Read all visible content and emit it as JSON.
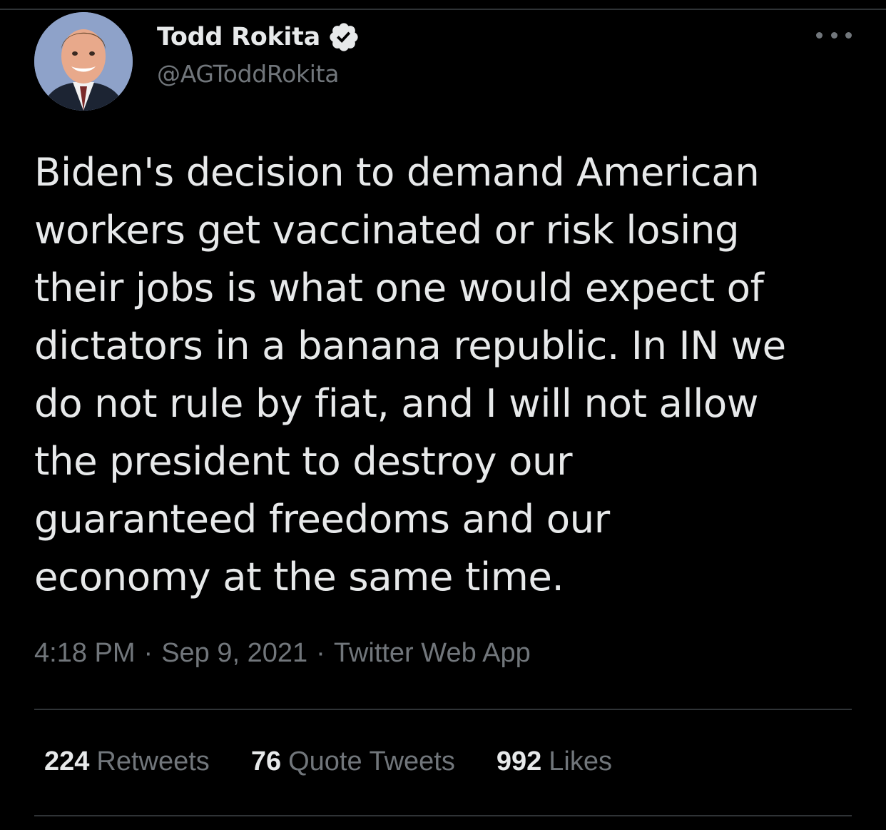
{
  "tweet": {
    "author": {
      "display_name": "Todd Rokita",
      "handle": "@AGToddRokita",
      "verified": true,
      "avatar_icon": "profile-photo"
    },
    "more_icon": "ellipsis-icon",
    "text_lines": [
      "Biden's decision to demand American",
      "workers get vaccinated or risk losing",
      "their jobs is what one would expect of",
      "dictators in a banana republic. In IN we",
      "do not rule by fiat, and I will not allow",
      "the president to destroy our",
      "guaranteed freedoms and our",
      "economy at the same time."
    ],
    "meta": {
      "time": "4:18 PM",
      "date": "Sep 9, 2021",
      "source": "Twitter Web App",
      "separator": "·"
    },
    "stats": {
      "retweets": {
        "count": "224",
        "label": "Retweets"
      },
      "quotes": {
        "count": "76",
        "label": "Quote Tweets"
      },
      "likes": {
        "count": "992",
        "label": "Likes"
      }
    }
  },
  "colors": {
    "background": "#000000",
    "primary_text": "#e7e9ea",
    "secondary_text": "#71767b",
    "divider": "#2f3336",
    "verified_badge": "#e7e9ea"
  }
}
